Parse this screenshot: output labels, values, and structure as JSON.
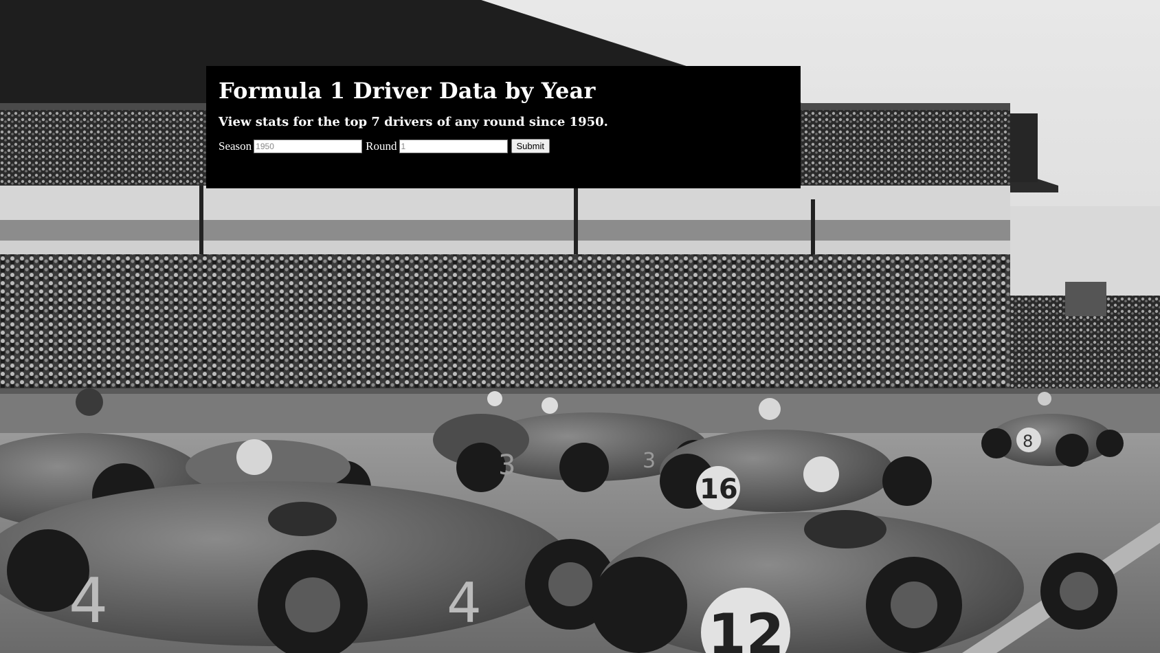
{
  "header": {
    "title": "Formula 1 Driver Data by Year",
    "subtitle": "View stats for the top 7 drivers of any round since 1950."
  },
  "form": {
    "season_label": "Season",
    "season_placeholder": "1950",
    "round_label": "Round",
    "round_placeholder": "1",
    "submit_label": "Submit"
  },
  "background": {
    "subject": "black-and-white photograph of vintage Formula 1 race cars in front of a crowded grandstand",
    "car_numbers": [
      "4",
      "3",
      "16",
      "8",
      "12"
    ]
  }
}
